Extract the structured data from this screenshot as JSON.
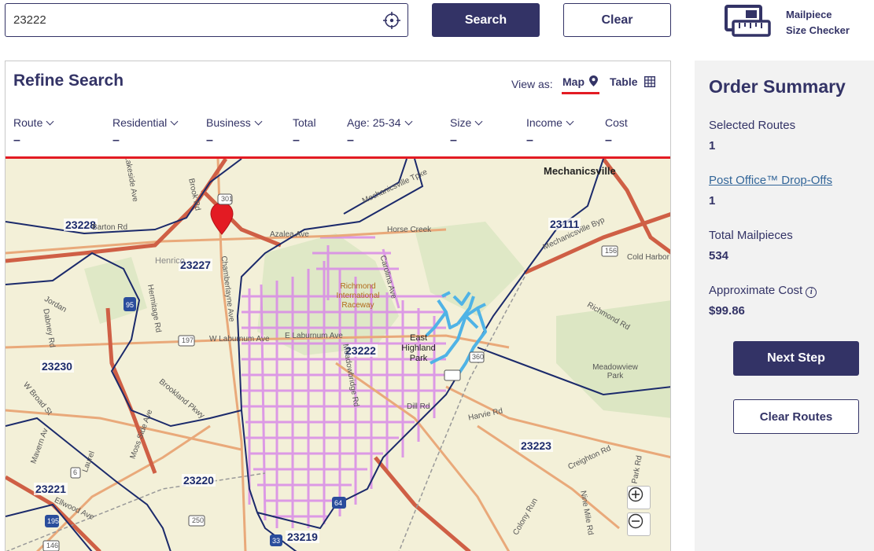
{
  "search": {
    "value": "23222",
    "placeholder": "",
    "search_label": "Search",
    "clear_label": "Clear"
  },
  "checker": {
    "label_line1": "Mailpiece",
    "label_line2": "Size Checker"
  },
  "refine": {
    "title": "Refine Search",
    "view_as_label": "View as:",
    "view_map": "Map",
    "view_table": "Table",
    "filters": [
      {
        "label": "Route",
        "value": "–"
      },
      {
        "label": "Residential",
        "value": "–"
      },
      {
        "label": "Business",
        "value": "–"
      },
      {
        "label": "Total",
        "value": "–"
      },
      {
        "label": "Age: 25-34",
        "value": "–"
      },
      {
        "label": "Size",
        "value": "–"
      },
      {
        "label": "Income",
        "value": "–"
      },
      {
        "label": "Cost",
        "value": "–"
      }
    ]
  },
  "map": {
    "zips": [
      "23228",
      "23227",
      "23111",
      "23230",
      "23222",
      "23220",
      "23223",
      "23221",
      "23219"
    ],
    "places": [
      "Mechanicsville",
      "East Highland Park",
      "Richmond International Raceway",
      "Meadowview Park",
      "Henrico"
    ],
    "roads": [
      "Azalea Ave",
      "Horse Creek",
      "Brook Rd",
      "Hermitage Rd",
      "W Laburnum Ave",
      "E Laburnum Ave",
      "Chamberlayne Ave",
      "Meadowbridge Rd",
      "Carolina Ave",
      "Brookland Pkwy",
      "W Broad St",
      "Dill Rd",
      "Harvie Rd",
      "Creighton Rd",
      "Mechanicsville Tpke",
      "Cold Harbor",
      "Mechanicsville Byp",
      "Lakeside Ave",
      "Dabney Rd",
      "Jordan",
      "Ellwood Ave",
      "Mavern Av",
      "Moss Side Ave",
      "Laurel",
      "Richmond Rd",
      "Colony Run",
      "Nine Mile Rd",
      "Park Rd",
      "Azalea Ave",
      "Barton Rd"
    ],
    "shields": [
      "301",
      "95",
      "197",
      "156",
      "250",
      "64",
      "195",
      "6",
      "146",
      "33",
      "360"
    ],
    "zoom_in": "+",
    "zoom_out": "−",
    "pin_color": "#e31b23",
    "selected_route_color": "#4fb3e6",
    "zip_highlight_color": "#d98ae8"
  },
  "summary": {
    "title": "Order Summary",
    "selected_routes_label": "Selected Routes",
    "selected_routes_value": "1",
    "drop_offs_label": "Post Office™ Drop-Offs",
    "drop_offs_value": "1",
    "total_mailpieces_label": "Total Mailpieces",
    "total_mailpieces_value": "534",
    "approx_cost_label": "Approximate Cost",
    "approx_cost_value": "$99.86",
    "next_step_label": "Next Step",
    "clear_routes_label": "Clear Routes"
  },
  "colors": {
    "brand_navy": "#333366",
    "accent_red": "#e31b23",
    "sidebar_bg": "#f2f2f2",
    "link": "#336699"
  }
}
